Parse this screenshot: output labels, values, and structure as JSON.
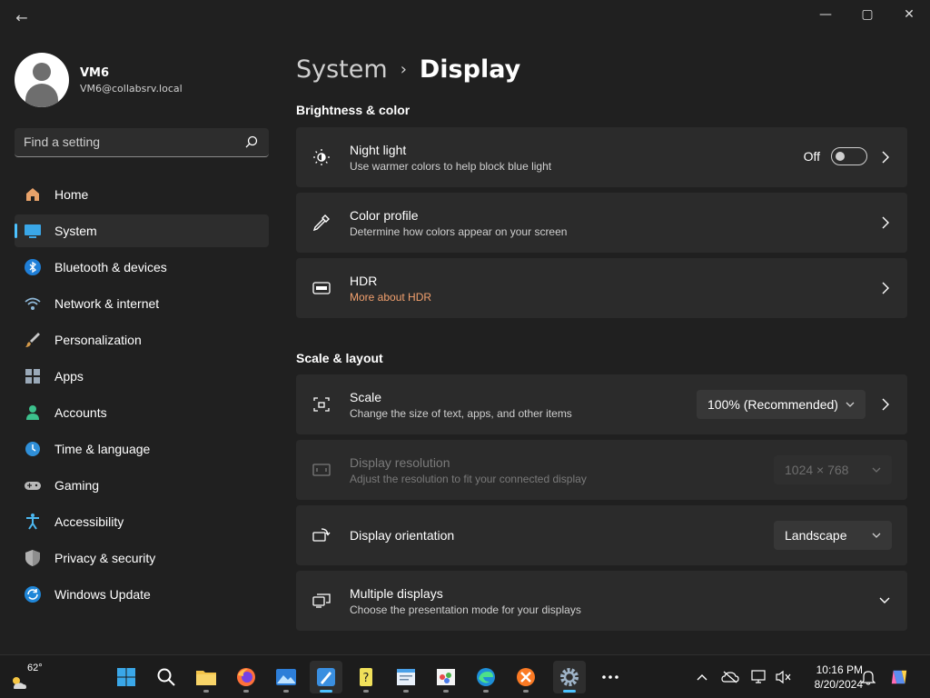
{
  "window": {
    "back_label": "←",
    "minimize": "—",
    "maximize": "▢",
    "close": "✕"
  },
  "profile": {
    "name": "VM6",
    "email": "VM6@collabsrv.local"
  },
  "search": {
    "placeholder": "Find a setting"
  },
  "nav": {
    "items": [
      {
        "label": "Home",
        "icon": "home-icon"
      },
      {
        "label": "System",
        "icon": "system-monitor-icon",
        "active": true
      },
      {
        "label": "Bluetooth & devices",
        "icon": "bluetooth-icon"
      },
      {
        "label": "Network & internet",
        "icon": "network-icon"
      },
      {
        "label": "Personalization",
        "icon": "personalization-brush-icon"
      },
      {
        "label": "Apps",
        "icon": "apps-icon"
      },
      {
        "label": "Accounts",
        "icon": "accounts-icon"
      },
      {
        "label": "Time & language",
        "icon": "time-language-icon"
      },
      {
        "label": "Gaming",
        "icon": "gaming-controller-icon"
      },
      {
        "label": "Accessibility",
        "icon": "accessibility-icon"
      },
      {
        "label": "Privacy & security",
        "icon": "shield-icon"
      },
      {
        "label": "Windows Update",
        "icon": "windows-update-icon"
      }
    ]
  },
  "breadcrumb": {
    "parent": "System",
    "separator": "›",
    "current": "Display"
  },
  "sections": {
    "brightness": "Brightness & color",
    "scale_layout": "Scale & layout"
  },
  "cards": {
    "night_light": {
      "title": "Night light",
      "subtitle": "Use warmer colors to help block blue light",
      "toggle_state": "Off"
    },
    "color_profile": {
      "title": "Color profile",
      "subtitle": "Determine how colors appear on your screen"
    },
    "hdr": {
      "title": "HDR",
      "link": "More about HDR"
    },
    "scale": {
      "title": "Scale",
      "subtitle": "Change the size of text, apps, and other items",
      "value": "100% (Recommended)"
    },
    "resolution": {
      "title": "Display resolution",
      "subtitle": "Adjust the resolution to fit your connected display",
      "value": "1024 × 768"
    },
    "orientation": {
      "title": "Display orientation",
      "value": "Landscape"
    },
    "multiple": {
      "title": "Multiple displays",
      "subtitle": "Choose the presentation mode for your displays"
    }
  },
  "taskbar": {
    "weather_temp": "62°",
    "apps": [
      "start-icon",
      "search-icon",
      "file-explorer-icon",
      "firefox-icon",
      "photos-icon",
      "paint-icon",
      "help-icon",
      "notepad-icon",
      "paint-app-icon",
      "edge-icon",
      "xampp-icon",
      "settings-icon",
      "more-apps-icon"
    ],
    "time": "10:16 PM",
    "date": "8/20/2024"
  },
  "colors": {
    "accent": "#4cc2ff",
    "background": "#202020",
    "card": "#2b2b2b",
    "link": "#f2a06e"
  }
}
